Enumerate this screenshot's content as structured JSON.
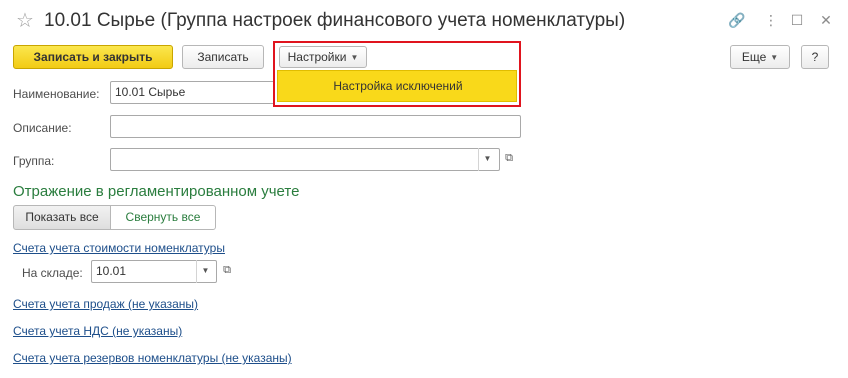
{
  "window": {
    "title": "10.01 Сырье (Группа настроек финансового учета номенклатуры)",
    "star_icon": "☆",
    "link_icon": "🔗",
    "menu_icon": "⋮",
    "maximize_icon": "☐",
    "close_icon": "✕"
  },
  "toolbar": {
    "save_close_label": "Записать и закрыть",
    "save_label": "Записать",
    "settings_label": "Настройки",
    "more_label": "Еще",
    "help_label": "?",
    "dropdown_arrow": "▼"
  },
  "settings_menu": {
    "items": [
      {
        "label": "Настройка исключений"
      }
    ]
  },
  "form": {
    "name_label": "Наименование:",
    "name_value": "10.01 Сырье",
    "description_label": "Описание:",
    "description_value": "",
    "group_label": "Группа:",
    "group_value": ""
  },
  "section": {
    "title": "Отражение в регламентированном учете",
    "show_all_label": "Показать все",
    "collapse_all_label": "Свернуть все"
  },
  "accounts": {
    "cost_link": "Счета учета стоимости номенклатуры",
    "warehouse_label": "На складе:",
    "warehouse_value": "10.01",
    "sales_link": "Счета учета продаж (не указаны)",
    "vat_link": "Счета учета НДС (не указаны)",
    "reserves_link": "Счета учета резервов номенклатуры (не указаны)"
  },
  "colors": {
    "accent_yellow": "#f2cb14",
    "highlight_red": "#e0141e",
    "section_green": "#2a7d3e",
    "link_blue": "#1d4e8a"
  }
}
